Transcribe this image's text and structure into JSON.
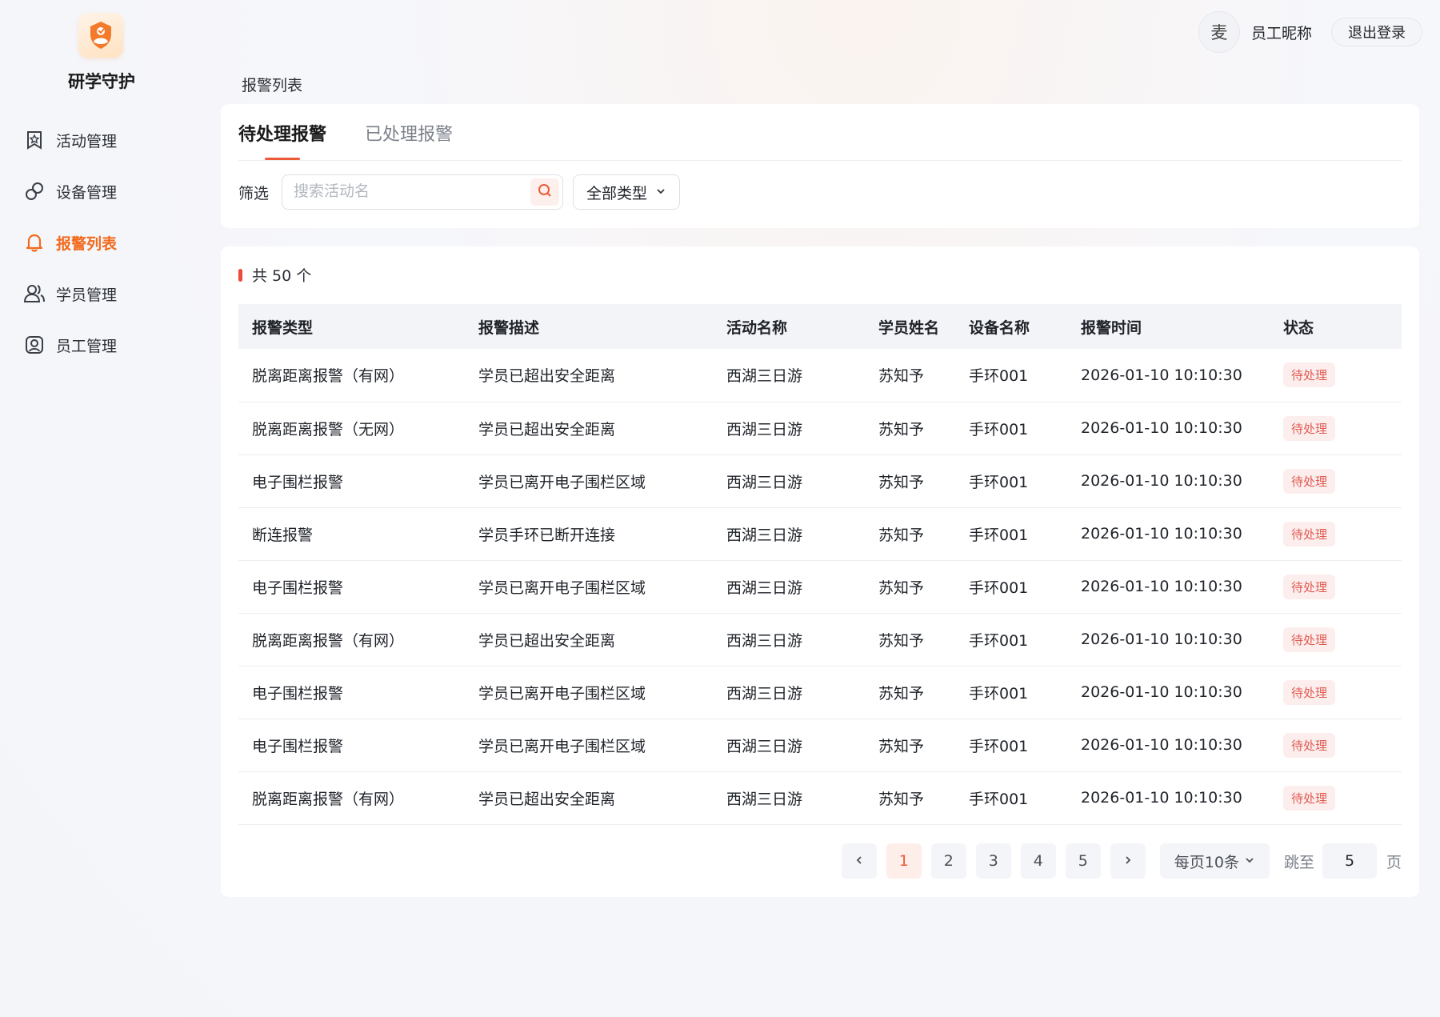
{
  "app": {
    "name": "研学守护",
    "logo_icon": "guardian-logo-icon"
  },
  "sidebar": {
    "items": [
      {
        "label": "活动管理",
        "icon": "bookmark-star-icon",
        "active": false
      },
      {
        "label": "设备管理",
        "icon": "link-chain-icon",
        "active": false
      },
      {
        "label": "报警列表",
        "icon": "bell-icon",
        "active": true
      },
      {
        "label": "学员管理",
        "icon": "users-icon",
        "active": false
      },
      {
        "label": "员工管理",
        "icon": "user-card-icon",
        "active": false
      }
    ]
  },
  "header": {
    "avatar_text": "麦",
    "nickname": "员工昵称",
    "logout_label": "退出登录"
  },
  "page": {
    "title": "报警列表"
  },
  "tabs": [
    {
      "label": "待处理报警",
      "active": true
    },
    {
      "label": "已处理报警",
      "active": false
    }
  ],
  "filter": {
    "label": "筛选",
    "search_placeholder": "搜索活动名",
    "type_select": "全部类型"
  },
  "summary": {
    "count_text": "共 50 个"
  },
  "table": {
    "columns": [
      "报警类型",
      "报警描述",
      "活动名称",
      "学员姓名",
      "设备名称",
      "报警时间",
      "状态"
    ],
    "rows": [
      [
        "脱离距离报警（有网）",
        "学员已超出安全距离",
        "西湖三日游",
        "苏知予",
        "手环001",
        "2026-01-10 10:10:30",
        "待处理"
      ],
      [
        "脱离距离报警（无网）",
        "学员已超出安全距离",
        "西湖三日游",
        "苏知予",
        "手环001",
        "2026-01-10 10:10:30",
        "待处理"
      ],
      [
        "电子围栏报警",
        "学员已离开电子围栏区域",
        "西湖三日游",
        "苏知予",
        "手环001",
        "2026-01-10 10:10:30",
        "待处理"
      ],
      [
        "断连报警",
        "学员手环已断开连接",
        "西湖三日游",
        "苏知予",
        "手环001",
        "2026-01-10 10:10:30",
        "待处理"
      ],
      [
        "电子围栏报警",
        "学员已离开电子围栏区域",
        "西湖三日游",
        "苏知予",
        "手环001",
        "2026-01-10 10:10:30",
        "待处理"
      ],
      [
        "脱离距离报警（有网）",
        "学员已超出安全距离",
        "西湖三日游",
        "苏知予",
        "手环001",
        "2026-01-10 10:10:30",
        "待处理"
      ],
      [
        "电子围栏报警",
        "学员已离开电子围栏区域",
        "西湖三日游",
        "苏知予",
        "手环001",
        "2026-01-10 10:10:30",
        "待处理"
      ],
      [
        "电子围栏报警",
        "学员已离开电子围栏区域",
        "西湖三日游",
        "苏知予",
        "手环001",
        "2026-01-10 10:10:30",
        "待处理"
      ],
      [
        "脱离距离报警（有网）",
        "学员已超出安全距离",
        "西湖三日游",
        "苏知予",
        "手环001",
        "2026-01-10 10:10:30",
        "待处理"
      ]
    ]
  },
  "pagination": {
    "pages": [
      "1",
      "2",
      "3",
      "4",
      "5"
    ],
    "current": "1",
    "per_page": "每页10条",
    "jump_label": "跳至",
    "jump_value": "5",
    "jump_suffix": "页"
  },
  "colors": {
    "accent": "#f26b1d",
    "danger": "#ec5a3a",
    "badge_bg": "#fdeeee"
  }
}
